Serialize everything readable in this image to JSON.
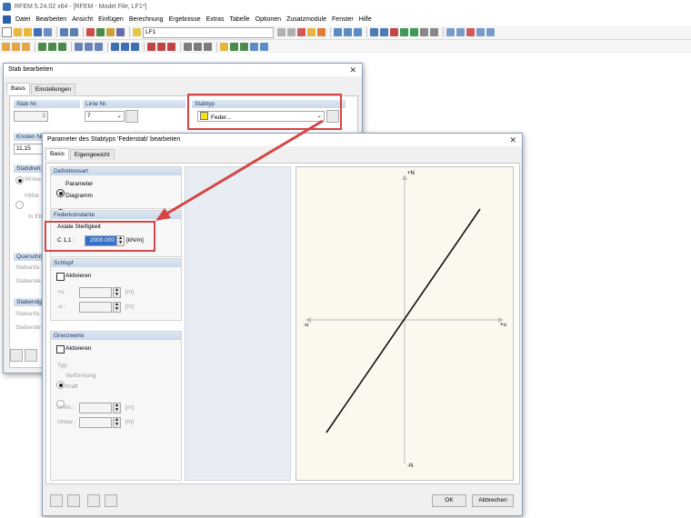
{
  "app": {
    "title": "RFEM 5.24.02 x64 - [RFEM - Model File, LF1*]"
  },
  "menu": [
    "Datei",
    "Bearbeiten",
    "Ansicht",
    "Einfügen",
    "Berechnung",
    "Ergebnisse",
    "Extras",
    "Tabelle",
    "Optionen",
    "Zusatzmodule",
    "Fenster",
    "Hilfe"
  ],
  "toolbar": {
    "loadcase": "LF1"
  },
  "stab_dialog": {
    "title": "Stab bearbeiten",
    "tabs": [
      "Basis",
      "Einstellungen"
    ],
    "stab_nr_label": "Stab Nr.",
    "stab_nr": "3",
    "linie_nr_label": "Linie Nr.",
    "linie_nr": "7",
    "stabtyp_label": "Stabtyp",
    "stabtyp_value": "Feder...",
    "knoten_label": "Knoten Nr.",
    "knoten_value": "11,15",
    "stabdrehung_label": "Stabdreh",
    "winkel_label": "Winke",
    "hilfskn_label": "Hilfsk",
    "in_ebene_label": "In Ebe",
    "querschnitt_label": "Querschn",
    "stabanfang1": "Stabanfa",
    "stabende1": "Stabende",
    "stabendgel_label": "Stabendge",
    "stabanfang2": "Stabanfa",
    "stabende2": "Stabende"
  },
  "param_dialog": {
    "title": "Parameter des Stabtyps 'Federstab' bearbeiten",
    "tabs": [
      "Basis",
      "Eigengewicht"
    ],
    "definitionsart": {
      "header": "Definitionsart",
      "opt_parameter": "Parameter",
      "opt_diagramm": "Diagramm"
    },
    "federkonstante": {
      "header": "Federkonstante",
      "axiale_label": "Axiale Steifigkeit",
      "c_label": "C 1,1 :",
      "value": "2000.000",
      "unit": "[kN/m]"
    },
    "schlupf": {
      "header": "Schlupf",
      "aktivieren": "Aktivieren",
      "plus_u": "+u :",
      "minus_u": "-u :",
      "unit_m1": "[m]",
      "unit_m2": "[m]"
    },
    "grenzwerte": {
      "header": "Grenzwerte",
      "aktivieren": "Aktivieren",
      "typ_label": "Typ:",
      "opt_verformung": "Verformung",
      "opt_kraft": "Kraft",
      "umin": "Umin :",
      "umax": "Umax :",
      "unit_m1": "[m]",
      "unit_m2": "[m]"
    },
    "diagram": {
      "top": "+N",
      "bottom": "-N",
      "left": "-u",
      "right": "+u"
    },
    "ok": "OK",
    "cancel": "Abbrechen"
  },
  "colors": {
    "accent_red": "#d64545",
    "group_header": "#c9d7e8",
    "diagram_bg": "#fbf8ee"
  }
}
